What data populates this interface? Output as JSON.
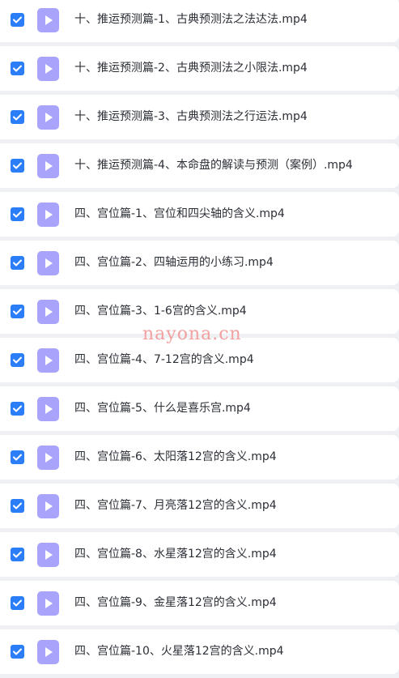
{
  "files": [
    {
      "name": "十、推运预测篇-1、古典预测法之法达法.mp4",
      "checked": true
    },
    {
      "name": "十、推运预测篇-2、古典预测法之小限法.mp4",
      "checked": true
    },
    {
      "name": "十、推运预测篇-3、古典预测法之行运法.mp4",
      "checked": true
    },
    {
      "name": "十、推运预测篇-4、本命盘的解读与预测（案例）.mp4",
      "checked": true
    },
    {
      "name": "四、宫位篇-1、宫位和四尖轴的含义.mp4",
      "checked": true
    },
    {
      "name": "四、宫位篇-2、四轴运用的小练习.mp4",
      "checked": true
    },
    {
      "name": "四、宫位篇-3、1-6宫的含义.mp4",
      "checked": true
    },
    {
      "name": "四、宫位篇-4、7-12宫的含义.mp4",
      "checked": true
    },
    {
      "name": "四、宫位篇-5、什么是喜乐宫.mp4",
      "checked": true
    },
    {
      "name": "四、宫位篇-6、太阳落12宫的含义.mp4",
      "checked": true
    },
    {
      "name": "四、宫位篇-7、月亮落12宫的含义.mp4",
      "checked": true
    },
    {
      "name": "四、宫位篇-8、水星落12宫的含义.mp4",
      "checked": true
    },
    {
      "name": "四、宫位篇-9、金星落12宫的含义.mp4",
      "checked": true
    },
    {
      "name": "四、宫位篇-10、火星落12宫的含义.mp4",
      "checked": true
    }
  ],
  "watermark": "nayona.cn",
  "colors": {
    "checkbox": "#2c7ef8",
    "video_icon": "#a9a4fb",
    "row_bg": "#ffffff",
    "page_bg": "#eef0f4",
    "watermark": "#f2a0a0"
  },
  "icons": {
    "checkbox": "checkmark-icon",
    "file": "video-file-icon"
  }
}
